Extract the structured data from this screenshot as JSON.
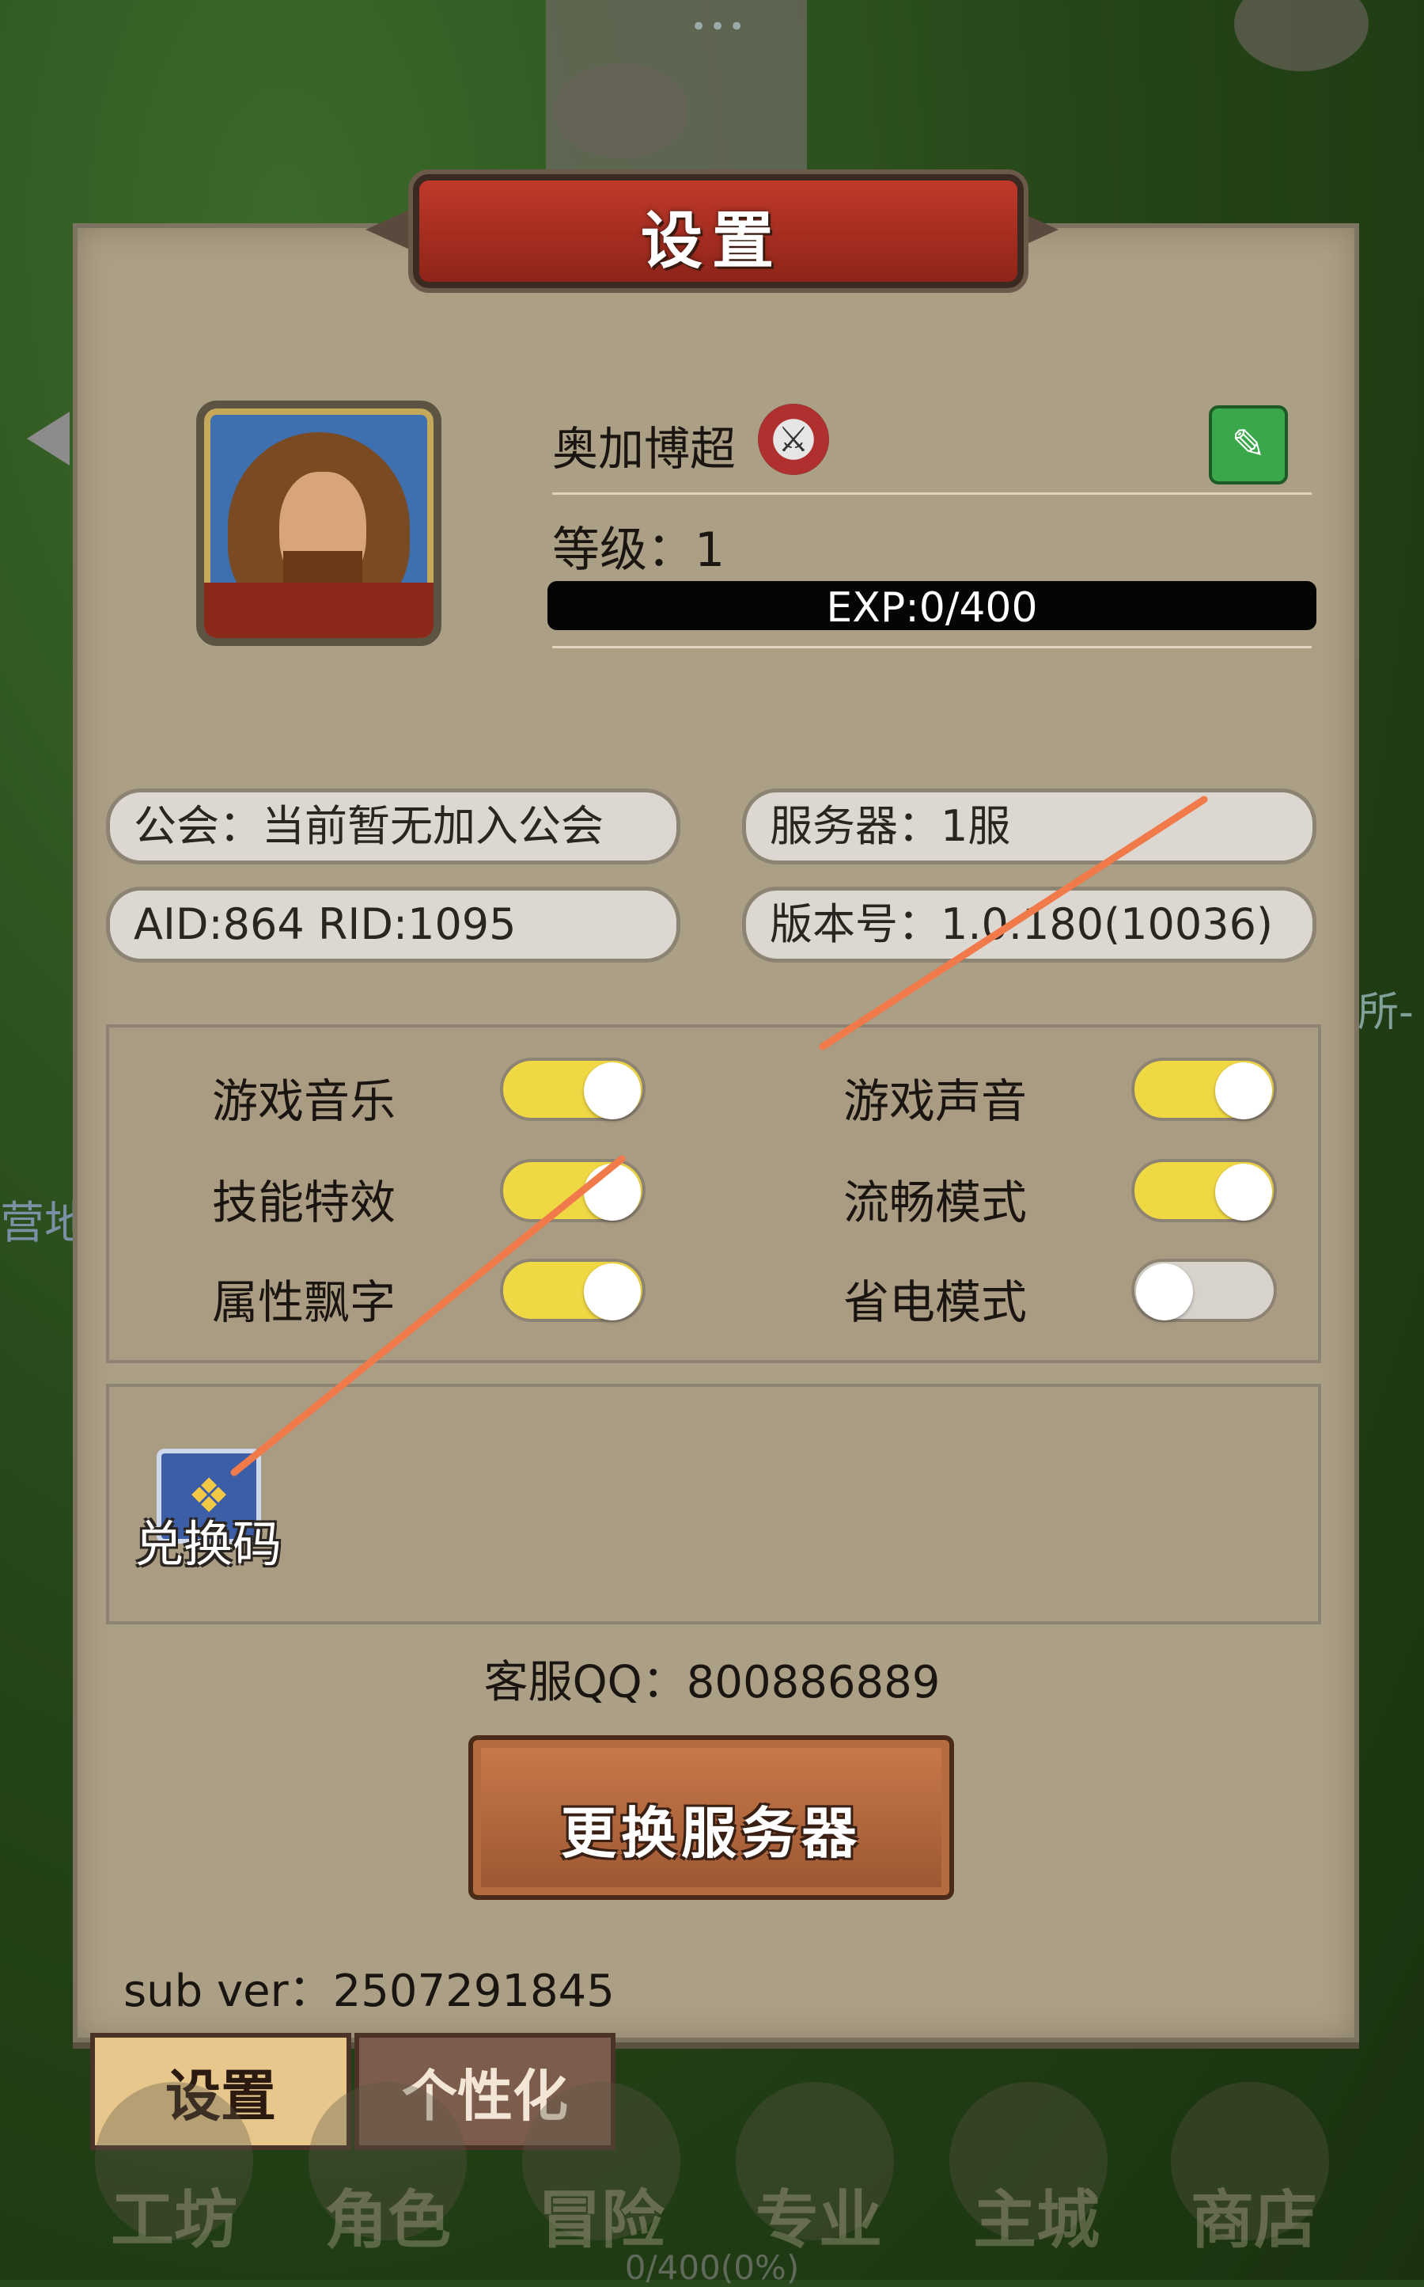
{
  "title": "设置",
  "player": {
    "name": "奥加博超",
    "level_label": "等级：1",
    "exp_text": "EXP:0/400",
    "exp_progress": 0
  },
  "info": {
    "guild": "公会：当前暂无加入公会",
    "server": "服务器：1服",
    "ids": "AID:864  RID:1095",
    "version": "版本号：1.0.180(10036)"
  },
  "settings": [
    {
      "label": "游戏音乐",
      "on": true
    },
    {
      "label": "游戏声音",
      "on": true
    },
    {
      "label": "技能特效",
      "on": true
    },
    {
      "label": "流畅模式",
      "on": true
    },
    {
      "label": "属性飘字",
      "on": true
    },
    {
      "label": "省电模式",
      "on": false
    }
  ],
  "redeem_label": "兑换码",
  "support_qq": "客服QQ：800886889",
  "change_server_label": "更换服务器",
  "sub_ver": "sub ver：2507291845",
  "tabs": {
    "settings": "设置",
    "personalize": "个性化"
  },
  "bottom_nav": [
    "工坊",
    "角色",
    "冒险",
    "专业",
    "主城",
    "商店"
  ],
  "bottom_progress": "0/400(0%)",
  "side_texts": {
    "left": "营地",
    "right": "所-"
  },
  "colors": {
    "toggle_on": "#f0d845",
    "toggle_off": "#d7d2cb",
    "annotation": "#f07a4a"
  },
  "icons": {
    "edit": "pencil-icon",
    "class": "sword-class-icon",
    "redeem": "gift-box-icon"
  }
}
